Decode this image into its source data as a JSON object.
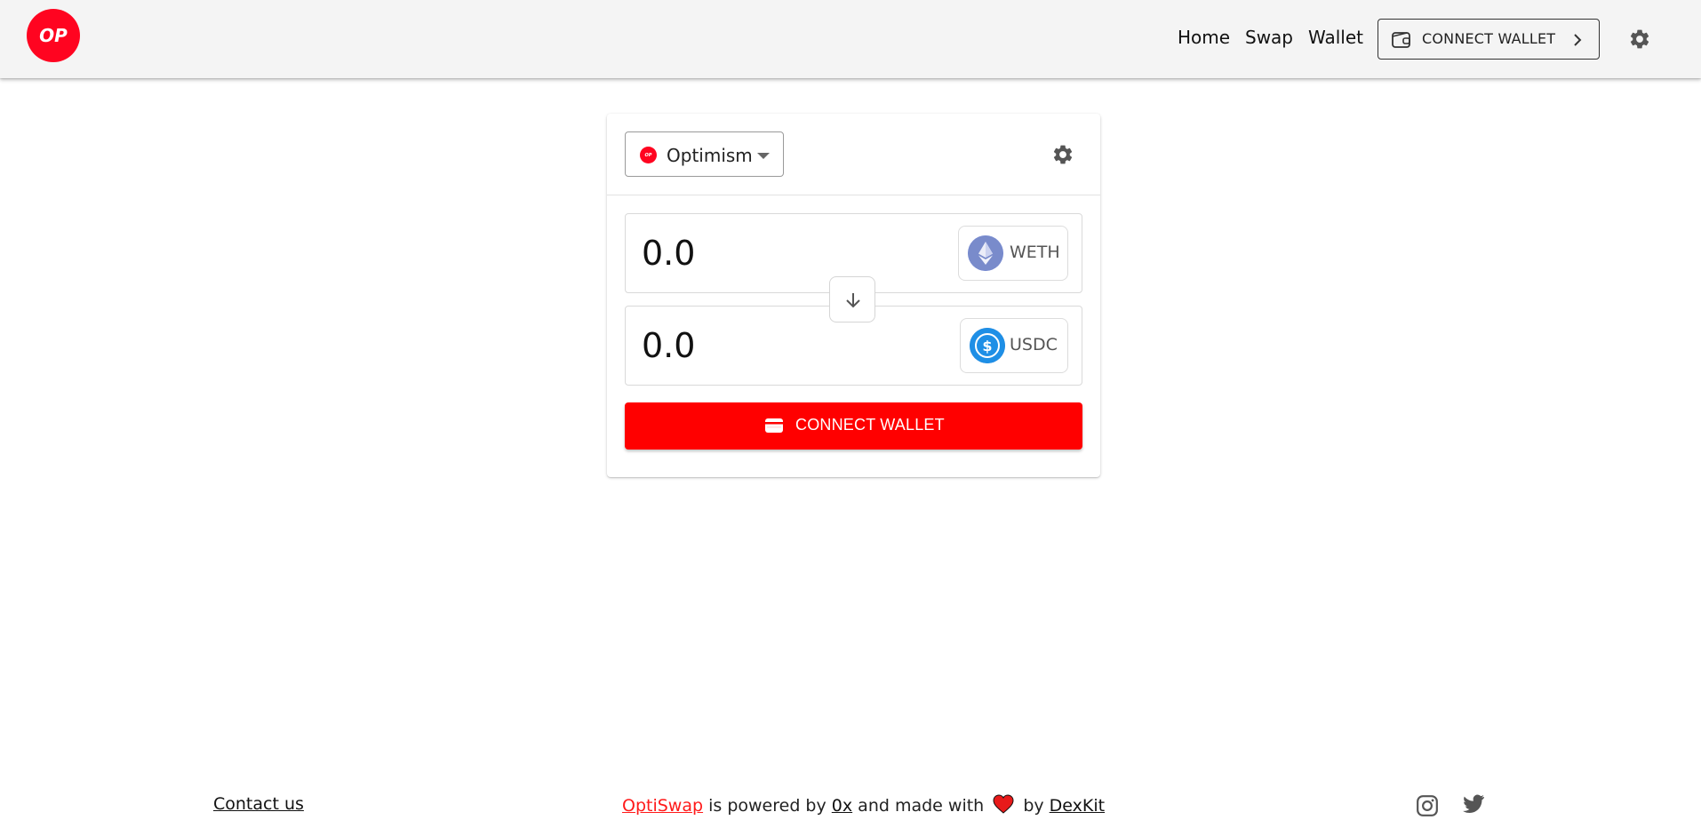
{
  "header": {
    "logo_text": "OP",
    "nav": {
      "home": "Home",
      "swap": "Swap",
      "wallet": "Wallet"
    },
    "connect_wallet_label": "CONNECT WALLET"
  },
  "swap": {
    "network": {
      "label": "Optimism",
      "icon_text": "OP"
    },
    "from": {
      "amount": "0.0",
      "token": "WETH"
    },
    "to": {
      "amount": "0.0",
      "token": "USDC"
    },
    "connect_wallet_label": "CONNECT WALLET"
  },
  "footer": {
    "contact": "Contact us",
    "brand": "OptiSwap",
    "powered_text": "is powered by",
    "powered_by": "0x",
    "made_with_text": "and made with",
    "by_text": "by",
    "maker": "DexKit"
  },
  "colors": {
    "brand_red": "#ff0420",
    "button_red": "#ff0000",
    "header_bg": "#f4f4f4"
  },
  "icons": [
    "gear-icon",
    "wallet-icon",
    "chevron-right-icon",
    "arrow-down-icon",
    "eth-icon",
    "usdc-icon",
    "heart-icon",
    "instagram-icon",
    "twitter-icon"
  ]
}
